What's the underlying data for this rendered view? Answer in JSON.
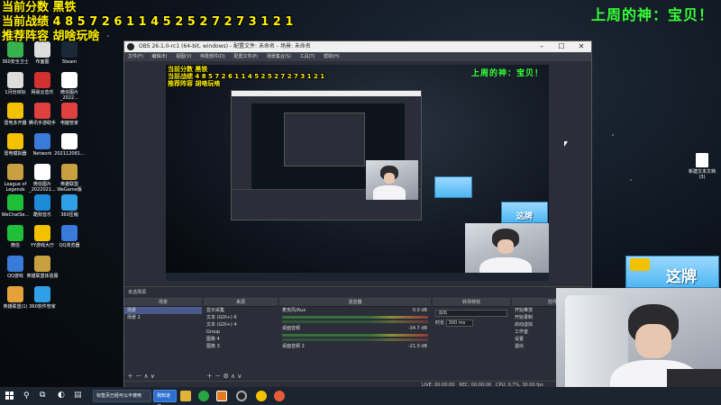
{
  "overlay": {
    "line1": "当前分数 黑铁",
    "line2": "当前战绩 4 8 5 7 2 6 1 1 4 5 2 5 2 7 2 7 3 1 2 1",
    "line3": "推荐阵容 胡啥玩啥",
    "weekly_god": "上周的神：宝贝！"
  },
  "desktop_icons": [
    {
      "label": "360安全卫士",
      "color": "#37b24d"
    },
    {
      "label": "1月份目标",
      "color": "#dddddd"
    },
    {
      "label": "雷电多开器",
      "color": "#f2c200"
    },
    {
      "label": "雷电模拟器",
      "color": "#f2c200"
    },
    {
      "label": "League of Legends",
      "color": "#c8a040"
    },
    {
      "label": "WeChatSe...",
      "color": "#1fbf3a"
    },
    {
      "label": "微信",
      "color": "#1fbf3a"
    },
    {
      "label": "QQ游戏",
      "color": "#3a7ad8"
    },
    {
      "label": "英雄联盟(1)",
      "color": "#e5a23a"
    },
    {
      "label": "布面图",
      "color": "#dddddd"
    },
    {
      "label": "网易云音乐",
      "color": "#d33030"
    },
    {
      "label": "腾讯手游助手",
      "color": "#e04040"
    },
    {
      "label": "Network",
      "color": "#3a7ad8"
    },
    {
      "label": "微信图片_2022021...",
      "color": "#ffffff"
    },
    {
      "label": "酷狗音乐",
      "color": "#1d8ad8"
    },
    {
      "label": "YY游戏大厅",
      "color": "#f2c200"
    },
    {
      "label": "英雄联盟体验服",
      "color": "#c8a040"
    },
    {
      "label": "360软件管家",
      "color": "#2fa0e8"
    },
    {
      "label": "Steam",
      "color": "#1b2838"
    },
    {
      "label": "微信图片_2022...",
      "color": "#ffffff"
    },
    {
      "label": "电脑管家",
      "color": "#e04040"
    },
    {
      "label": "202112081...",
      "color": "#ffffff"
    },
    {
      "label": "英雄联盟WeGame版",
      "color": "#c8a040"
    },
    {
      "label": "360压缩",
      "color": "#2fa0e8"
    },
    {
      "label": "QQ浏览器",
      "color": "#3a7ad8"
    },
    {
      "label": "新建文本文档(3)",
      "color": "#ffffff"
    }
  ],
  "obs": {
    "title": "OBS 26.1.0-rc1 (64-bit, windows) - 配置文件: 未命名 - 场景: 未命名",
    "menu": [
      "文件(F)",
      "编辑(E)",
      "视图(V)",
      "停靠部件(D)",
      "配置文件(P)",
      "场景集合(S)",
      "工具(T)",
      "帮助(H)"
    ],
    "no_source": "未选择源",
    "docks": {
      "scenes": {
        "title": "场景",
        "items": [
          "场景",
          "场景 2"
        ]
      },
      "sources": {
        "title": "来源",
        "items": [
          "显示采集",
          "文本 (GDI+) 6",
          "文本 (GDI+) 4",
          "Group",
          "图像 4",
          "图像 3"
        ]
      },
      "mixer": {
        "title": "混音器",
        "channels": [
          {
            "name": "麦克风/Aux",
            "db": "0.0 dB"
          },
          {
            "name": "桌面音频",
            "db": "-34.7 dB"
          },
          {
            "name": "桌面音频 2",
            "db": "-21.0 dB"
          }
        ]
      },
      "transitions": {
        "title": "转场特效",
        "type": "淡出",
        "duration_label": "时长",
        "duration": "300 ms"
      },
      "controls": {
        "title": "控件",
        "items": [
          "开始推流",
          "开始录制",
          "启动虚拟",
          "工作室",
          "设置",
          "退出"
        ]
      }
    },
    "status": {
      "live": "LIVE: 00:00:00",
      "rec": "REC: 00:00:00",
      "cpu": "CPU: 0.7%, 30.00 fps"
    }
  },
  "taskbar": {
    "search_placeholder": "在这里输入你要搜索的内容",
    "notice": "标签页已经可以不使用",
    "notice_button": "我知道了"
  },
  "stream_banner": "这牌",
  "desktop_file": "新建文本文档(3)"
}
